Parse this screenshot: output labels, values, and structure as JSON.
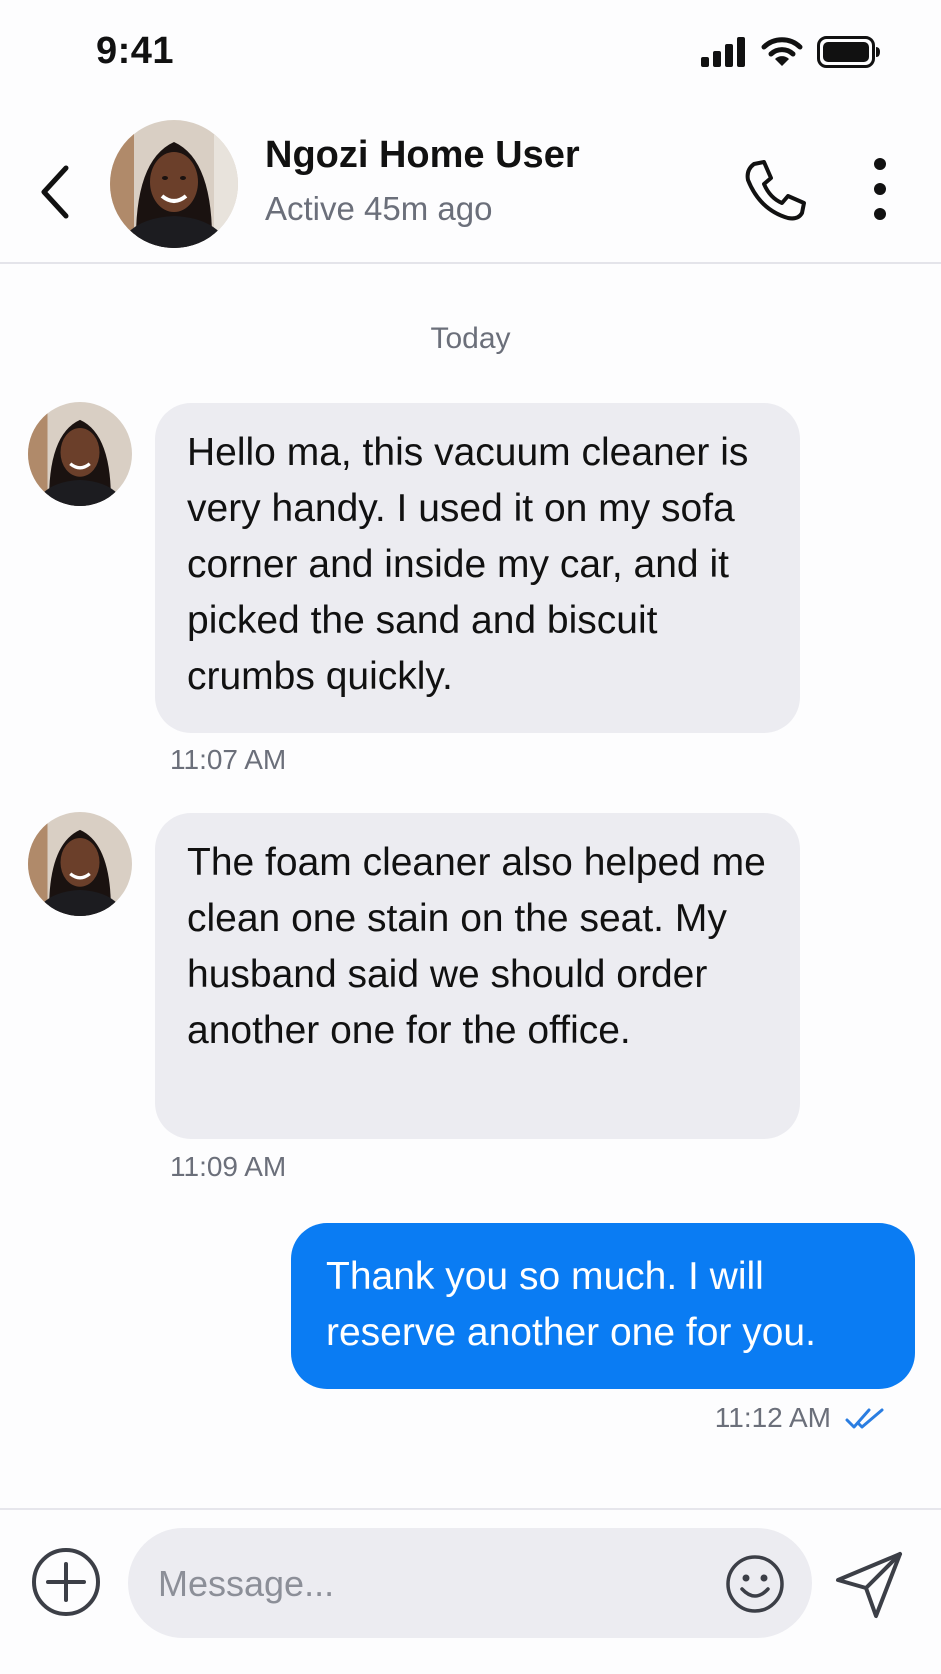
{
  "status_bar": {
    "time": "9:41"
  },
  "header": {
    "contact_name": "Ngozi Home User",
    "presence": "Active 45m ago"
  },
  "thread": {
    "date_separator": "Today",
    "messages": [
      {
        "direction": "incoming",
        "text": "Hello ma, this vacuum cleaner is very handy. I used it on my sofa corner and inside my car, and it picked the sand and biscuit crumbs quickly.",
        "time": "11:07 AM"
      },
      {
        "direction": "incoming",
        "text": "The foam cleaner also helped me clean one stain on the seat. My husband said we should order another one for the office.",
        "time": "11:09 AM"
      },
      {
        "direction": "outgoing",
        "text": "Thank you so much. I will reserve another one for you.",
        "time": "11:12 AM",
        "read": true
      }
    ]
  },
  "composer": {
    "placeholder": "Message..."
  },
  "colors": {
    "accent": "#0a7cf3",
    "incoming_bubble": "#ececf1",
    "read_receipt": "#2a7de1",
    "secondary_text": "#6b6f7a"
  },
  "icons": [
    "signal-icon",
    "wifi-icon",
    "battery-icon",
    "chevron-left-icon",
    "phone-icon",
    "more-vertical-icon",
    "plus-circle-icon",
    "smiley-icon",
    "send-icon",
    "double-check-icon"
  ]
}
